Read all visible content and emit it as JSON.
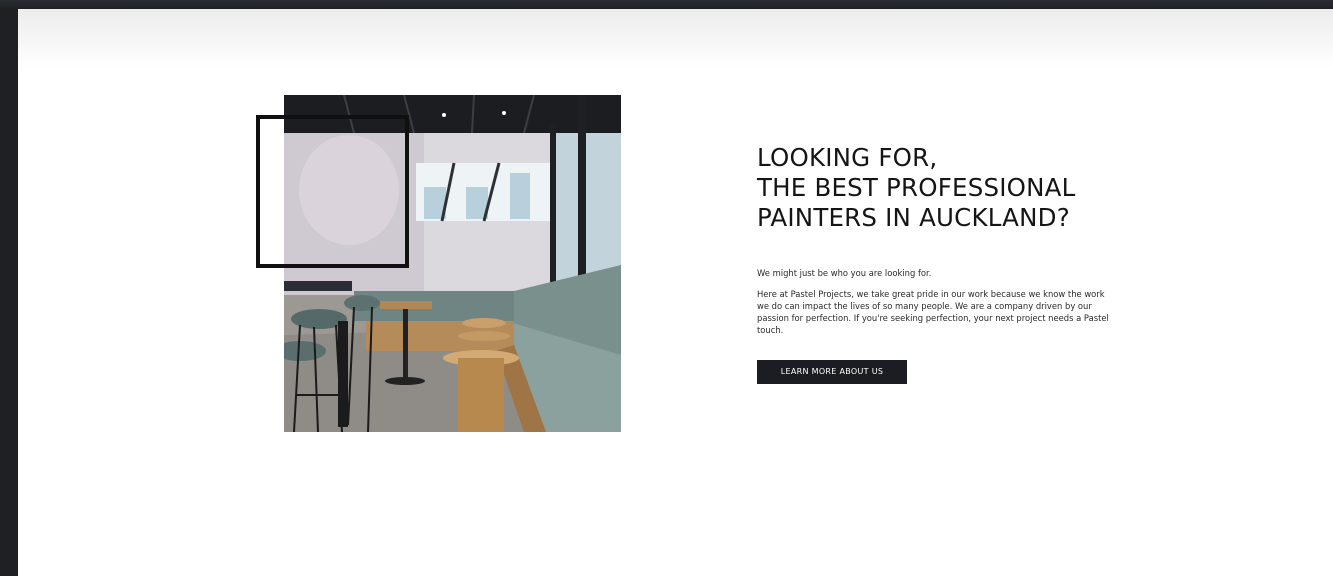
{
  "about_section": {
    "heading_lines": [
      "LOOKING FOR,",
      "THE BEST PROFESSIONAL",
      "PAINTERS IN AUCKLAND?"
    ],
    "intro": "We might just be who you are looking for.",
    "body": "Here at Pastel Projects, we take great pride in our work because we know the work we do can impact the lives of so many people. We are a company driven by our passion for perfection. If you're seeking perfection, your next project needs a Pastel touch.",
    "cta_label": "LEARN MORE ABOUT US"
  },
  "colors": {
    "button_background": "#1b1d22",
    "heading_text": "#151515",
    "frame_outline": "#101010",
    "window_background": "#1e2024"
  }
}
